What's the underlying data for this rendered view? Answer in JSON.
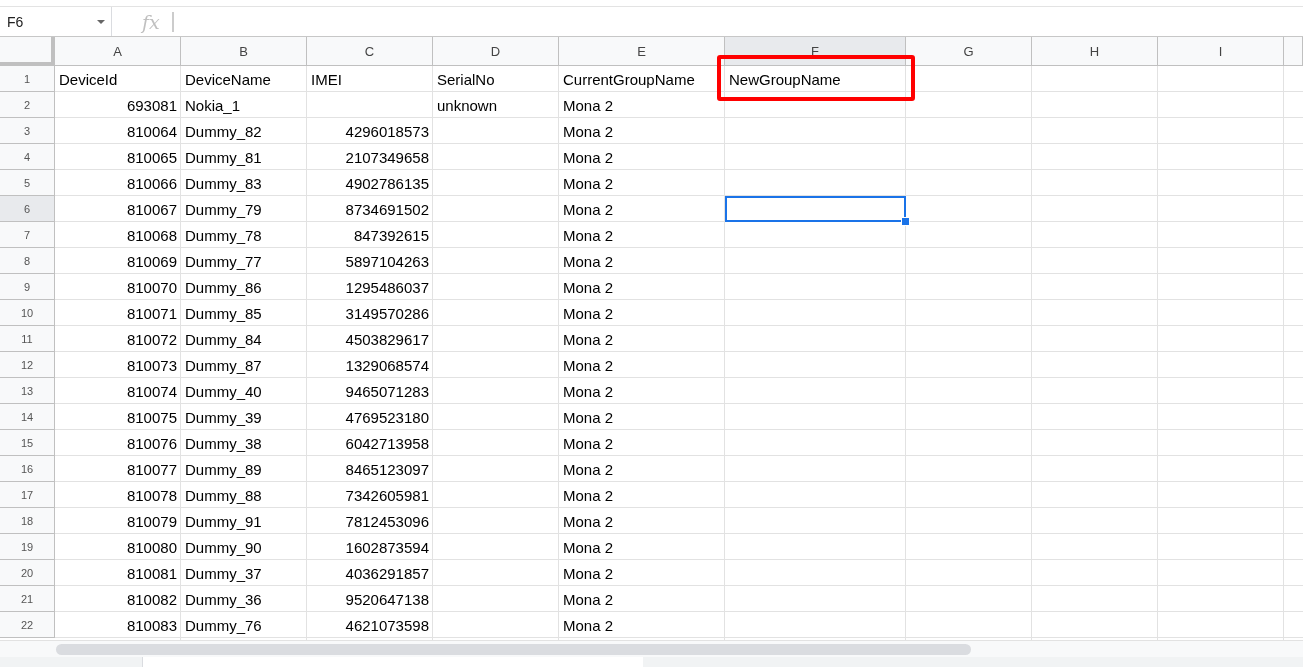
{
  "name_box": {
    "value": "F6"
  },
  "formula_bar": {
    "icon_text": "fx"
  },
  "columns": [
    {
      "label": "A",
      "selected": false,
      "annotated": false
    },
    {
      "label": "B",
      "selected": false,
      "annotated": false
    },
    {
      "label": "C",
      "selected": false,
      "annotated": false
    },
    {
      "label": "D",
      "selected": false,
      "annotated": false
    },
    {
      "label": "E",
      "selected": false,
      "annotated": false
    },
    {
      "label": "F",
      "selected": true,
      "annotated": true
    },
    {
      "label": "G",
      "selected": false,
      "annotated": false
    },
    {
      "label": "H",
      "selected": false,
      "annotated": false
    },
    {
      "label": "I",
      "selected": false,
      "annotated": false
    }
  ],
  "rows": [
    {
      "number": "1",
      "selected": false,
      "cells": [
        {
          "value": "DeviceId",
          "kind": "text"
        },
        {
          "value": "DeviceName",
          "kind": "text"
        },
        {
          "value": "IMEI",
          "kind": "text"
        },
        {
          "value": "SerialNo",
          "kind": "text"
        },
        {
          "value": "CurrentGroupName",
          "kind": "text"
        },
        {
          "value": "NewGroupName",
          "kind": "text"
        }
      ]
    },
    {
      "number": "2",
      "selected": false,
      "cells": [
        {
          "value": "693081",
          "kind": "number"
        },
        {
          "value": "Nokia_1",
          "kind": "text"
        },
        null,
        {
          "value": "unknown",
          "kind": "text"
        },
        {
          "value": "Mona 2",
          "kind": "text"
        }
      ]
    },
    {
      "number": "3",
      "selected": false,
      "cells": [
        {
          "value": "810064",
          "kind": "number"
        },
        {
          "value": "Dummy_82",
          "kind": "text"
        },
        {
          "value": "4296018573",
          "kind": "number"
        },
        null,
        {
          "value": "Mona 2",
          "kind": "text"
        }
      ]
    },
    {
      "number": "4",
      "selected": false,
      "cells": [
        {
          "value": "810065",
          "kind": "number"
        },
        {
          "value": "Dummy_81",
          "kind": "text"
        },
        {
          "value": "2107349658",
          "kind": "number"
        },
        null,
        {
          "value": "Mona 2",
          "kind": "text"
        }
      ]
    },
    {
      "number": "5",
      "selected": false,
      "cells": [
        {
          "value": "810066",
          "kind": "number"
        },
        {
          "value": "Dummy_83",
          "kind": "text"
        },
        {
          "value": "4902786135",
          "kind": "number"
        },
        null,
        {
          "value": "Mona 2",
          "kind": "text"
        }
      ]
    },
    {
      "number": "6",
      "selected": true,
      "cells": [
        {
          "value": "810067",
          "kind": "number"
        },
        {
          "value": "Dummy_79",
          "kind": "text"
        },
        {
          "value": "8734691502",
          "kind": "number"
        },
        null,
        {
          "value": "Mona 2",
          "kind": "text"
        }
      ]
    },
    {
      "number": "7",
      "selected": false,
      "cells": [
        {
          "value": "810068",
          "kind": "number"
        },
        {
          "value": "Dummy_78",
          "kind": "text"
        },
        {
          "value": "847392615",
          "kind": "number"
        },
        null,
        {
          "value": "Mona 2",
          "kind": "text"
        }
      ]
    },
    {
      "number": "8",
      "selected": false,
      "cells": [
        {
          "value": "810069",
          "kind": "number"
        },
        {
          "value": "Dummy_77",
          "kind": "text"
        },
        {
          "value": "5897104263",
          "kind": "number"
        },
        null,
        {
          "value": "Mona 2",
          "kind": "text"
        }
      ]
    },
    {
      "number": "9",
      "selected": false,
      "cells": [
        {
          "value": "810070",
          "kind": "number"
        },
        {
          "value": "Dummy_86",
          "kind": "text"
        },
        {
          "value": "1295486037",
          "kind": "number"
        },
        null,
        {
          "value": "Mona 2",
          "kind": "text"
        }
      ]
    },
    {
      "number": "10",
      "selected": false,
      "cells": [
        {
          "value": "810071",
          "kind": "number"
        },
        {
          "value": "Dummy_85",
          "kind": "text"
        },
        {
          "value": "3149570286",
          "kind": "number"
        },
        null,
        {
          "value": "Mona 2",
          "kind": "text"
        }
      ]
    },
    {
      "number": "11",
      "selected": false,
      "cells": [
        {
          "value": "810072",
          "kind": "number"
        },
        {
          "value": "Dummy_84",
          "kind": "text"
        },
        {
          "value": "4503829617",
          "kind": "number"
        },
        null,
        {
          "value": "Mona 2",
          "kind": "text"
        }
      ]
    },
    {
      "number": "12",
      "selected": false,
      "cells": [
        {
          "value": "810073",
          "kind": "number"
        },
        {
          "value": "Dummy_87",
          "kind": "text"
        },
        {
          "value": "1329068574",
          "kind": "number"
        },
        null,
        {
          "value": "Mona 2",
          "kind": "text"
        }
      ]
    },
    {
      "number": "13",
      "selected": false,
      "cells": [
        {
          "value": "810074",
          "kind": "number"
        },
        {
          "value": "Dummy_40",
          "kind": "text"
        },
        {
          "value": "9465071283",
          "kind": "number"
        },
        null,
        {
          "value": "Mona 2",
          "kind": "text"
        }
      ]
    },
    {
      "number": "14",
      "selected": false,
      "cells": [
        {
          "value": "810075",
          "kind": "number"
        },
        {
          "value": "Dummy_39",
          "kind": "text"
        },
        {
          "value": "4769523180",
          "kind": "number"
        },
        null,
        {
          "value": "Mona 2",
          "kind": "text"
        }
      ]
    },
    {
      "number": "15",
      "selected": false,
      "cells": [
        {
          "value": "810076",
          "kind": "number"
        },
        {
          "value": "Dummy_38",
          "kind": "text"
        },
        {
          "value": "6042713958",
          "kind": "number"
        },
        null,
        {
          "value": "Mona 2",
          "kind": "text"
        }
      ]
    },
    {
      "number": "16",
      "selected": false,
      "cells": [
        {
          "value": "810077",
          "kind": "number"
        },
        {
          "value": "Dummy_89",
          "kind": "text"
        },
        {
          "value": "8465123097",
          "kind": "number"
        },
        null,
        {
          "value": "Mona 2",
          "kind": "text"
        }
      ]
    },
    {
      "number": "17",
      "selected": false,
      "cells": [
        {
          "value": "810078",
          "kind": "number"
        },
        {
          "value": "Dummy_88",
          "kind": "text"
        },
        {
          "value": "7342605981",
          "kind": "number"
        },
        null,
        {
          "value": "Mona 2",
          "kind": "text"
        }
      ]
    },
    {
      "number": "18",
      "selected": false,
      "cells": [
        {
          "value": "810079",
          "kind": "number"
        },
        {
          "value": "Dummy_91",
          "kind": "text"
        },
        {
          "value": "7812453096",
          "kind": "number"
        },
        null,
        {
          "value": "Mona 2",
          "kind": "text"
        }
      ]
    },
    {
      "number": "19",
      "selected": false,
      "cells": [
        {
          "value": "810080",
          "kind": "number"
        },
        {
          "value": "Dummy_90",
          "kind": "text"
        },
        {
          "value": "1602873594",
          "kind": "number"
        },
        null,
        {
          "value": "Mona 2",
          "kind": "text"
        }
      ]
    },
    {
      "number": "20",
      "selected": false,
      "cells": [
        {
          "value": "810081",
          "kind": "number"
        },
        {
          "value": "Dummy_37",
          "kind": "text"
        },
        {
          "value": "4036291857",
          "kind": "number"
        },
        null,
        {
          "value": "Mona 2",
          "kind": "text"
        }
      ]
    },
    {
      "number": "21",
      "selected": false,
      "cells": [
        {
          "value": "810082",
          "kind": "number"
        },
        {
          "value": "Dummy_36",
          "kind": "text"
        },
        {
          "value": "9520647138",
          "kind": "number"
        },
        null,
        {
          "value": "Mona 2",
          "kind": "text"
        }
      ]
    },
    {
      "number": "22",
      "selected": false,
      "cells": [
        {
          "value": "810083",
          "kind": "number"
        },
        {
          "value": "Dummy_76",
          "kind": "text"
        },
        {
          "value": "4621073598",
          "kind": "number"
        },
        null,
        {
          "value": "Mona 2",
          "kind": "text"
        }
      ]
    }
  ]
}
